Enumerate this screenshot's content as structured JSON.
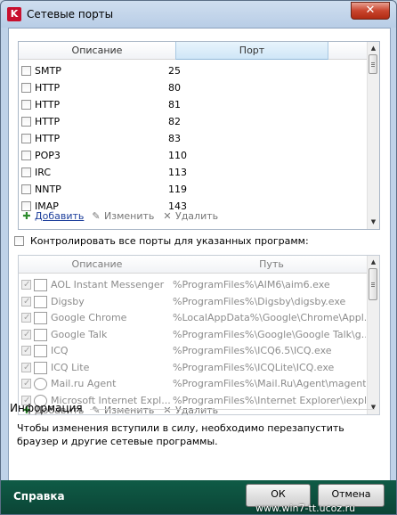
{
  "window": {
    "title": "Сетевые порты",
    "logo_letter": "K",
    "close_glyph": "✕"
  },
  "ports_table": {
    "columns": [
      "Описание",
      "Порт"
    ],
    "rows": [
      {
        "description": "SMTP",
        "port": "25"
      },
      {
        "description": "HTTP",
        "port": "80"
      },
      {
        "description": "HTTP",
        "port": "81"
      },
      {
        "description": "HTTP",
        "port": "82"
      },
      {
        "description": "HTTP",
        "port": "83"
      },
      {
        "description": "POP3",
        "port": "110"
      },
      {
        "description": "IRC",
        "port": "113"
      },
      {
        "description": "NNTP",
        "port": "119"
      },
      {
        "description": "IMAP",
        "port": "143"
      }
    ],
    "toolbar": {
      "add": "Добавить",
      "edit": "Изменить",
      "delete": "Удалить"
    }
  },
  "control_all_label": "Контролировать все порты для указанных программ:",
  "programs_table": {
    "columns": [
      "Описание",
      "Путь"
    ],
    "rows": [
      {
        "name": "AOL Instant Messenger",
        "path": "%ProgramFiles%\\AIM6\\aim6.exe"
      },
      {
        "name": "Digsby",
        "path": "%ProgramFiles%\\Digsby\\digsby.exe"
      },
      {
        "name": "Google Chrome",
        "path": "%LocalAppData%\\Google\\Chrome\\Appl..."
      },
      {
        "name": "Google Talk",
        "path": "%ProgramFiles%\\Google\\Google Talk\\g..."
      },
      {
        "name": "ICQ",
        "path": "%ProgramFiles%\\ICQ6.5\\ICQ.exe"
      },
      {
        "name": "ICQ Lite",
        "path": "%ProgramFiles%\\ICQLite\\ICQ.exe"
      },
      {
        "name": "Mail.ru Agent",
        "path": "%ProgramFiles%\\Mail.Ru\\Agent\\magent..."
      },
      {
        "name": "Microsoft Internet Expl...",
        "path": "%ProgramFiles%\\Internet Explorer\\iexpl..."
      }
    ],
    "toolbar": {
      "add": "Добавить",
      "edit": "Изменить",
      "delete": "Удалить"
    }
  },
  "info": {
    "title": "Информация",
    "text": "Чтобы изменения вступили в силу, необходимо перезапустить браузер и другие сетевые программы."
  },
  "footer": {
    "help": "Справка",
    "ok": "ОК",
    "cancel": "Отмена"
  },
  "watermark": "www.win7-tt.ucoz.ru",
  "icons": {
    "add": "plus-icon",
    "edit": "pencil-icon",
    "delete": "x-icon"
  },
  "colors": {
    "footer_bg": "#0f5b46",
    "link": "#1c3e9b",
    "add_icon": "#2e8b2e",
    "header_selected": "#cfe6f7"
  }
}
